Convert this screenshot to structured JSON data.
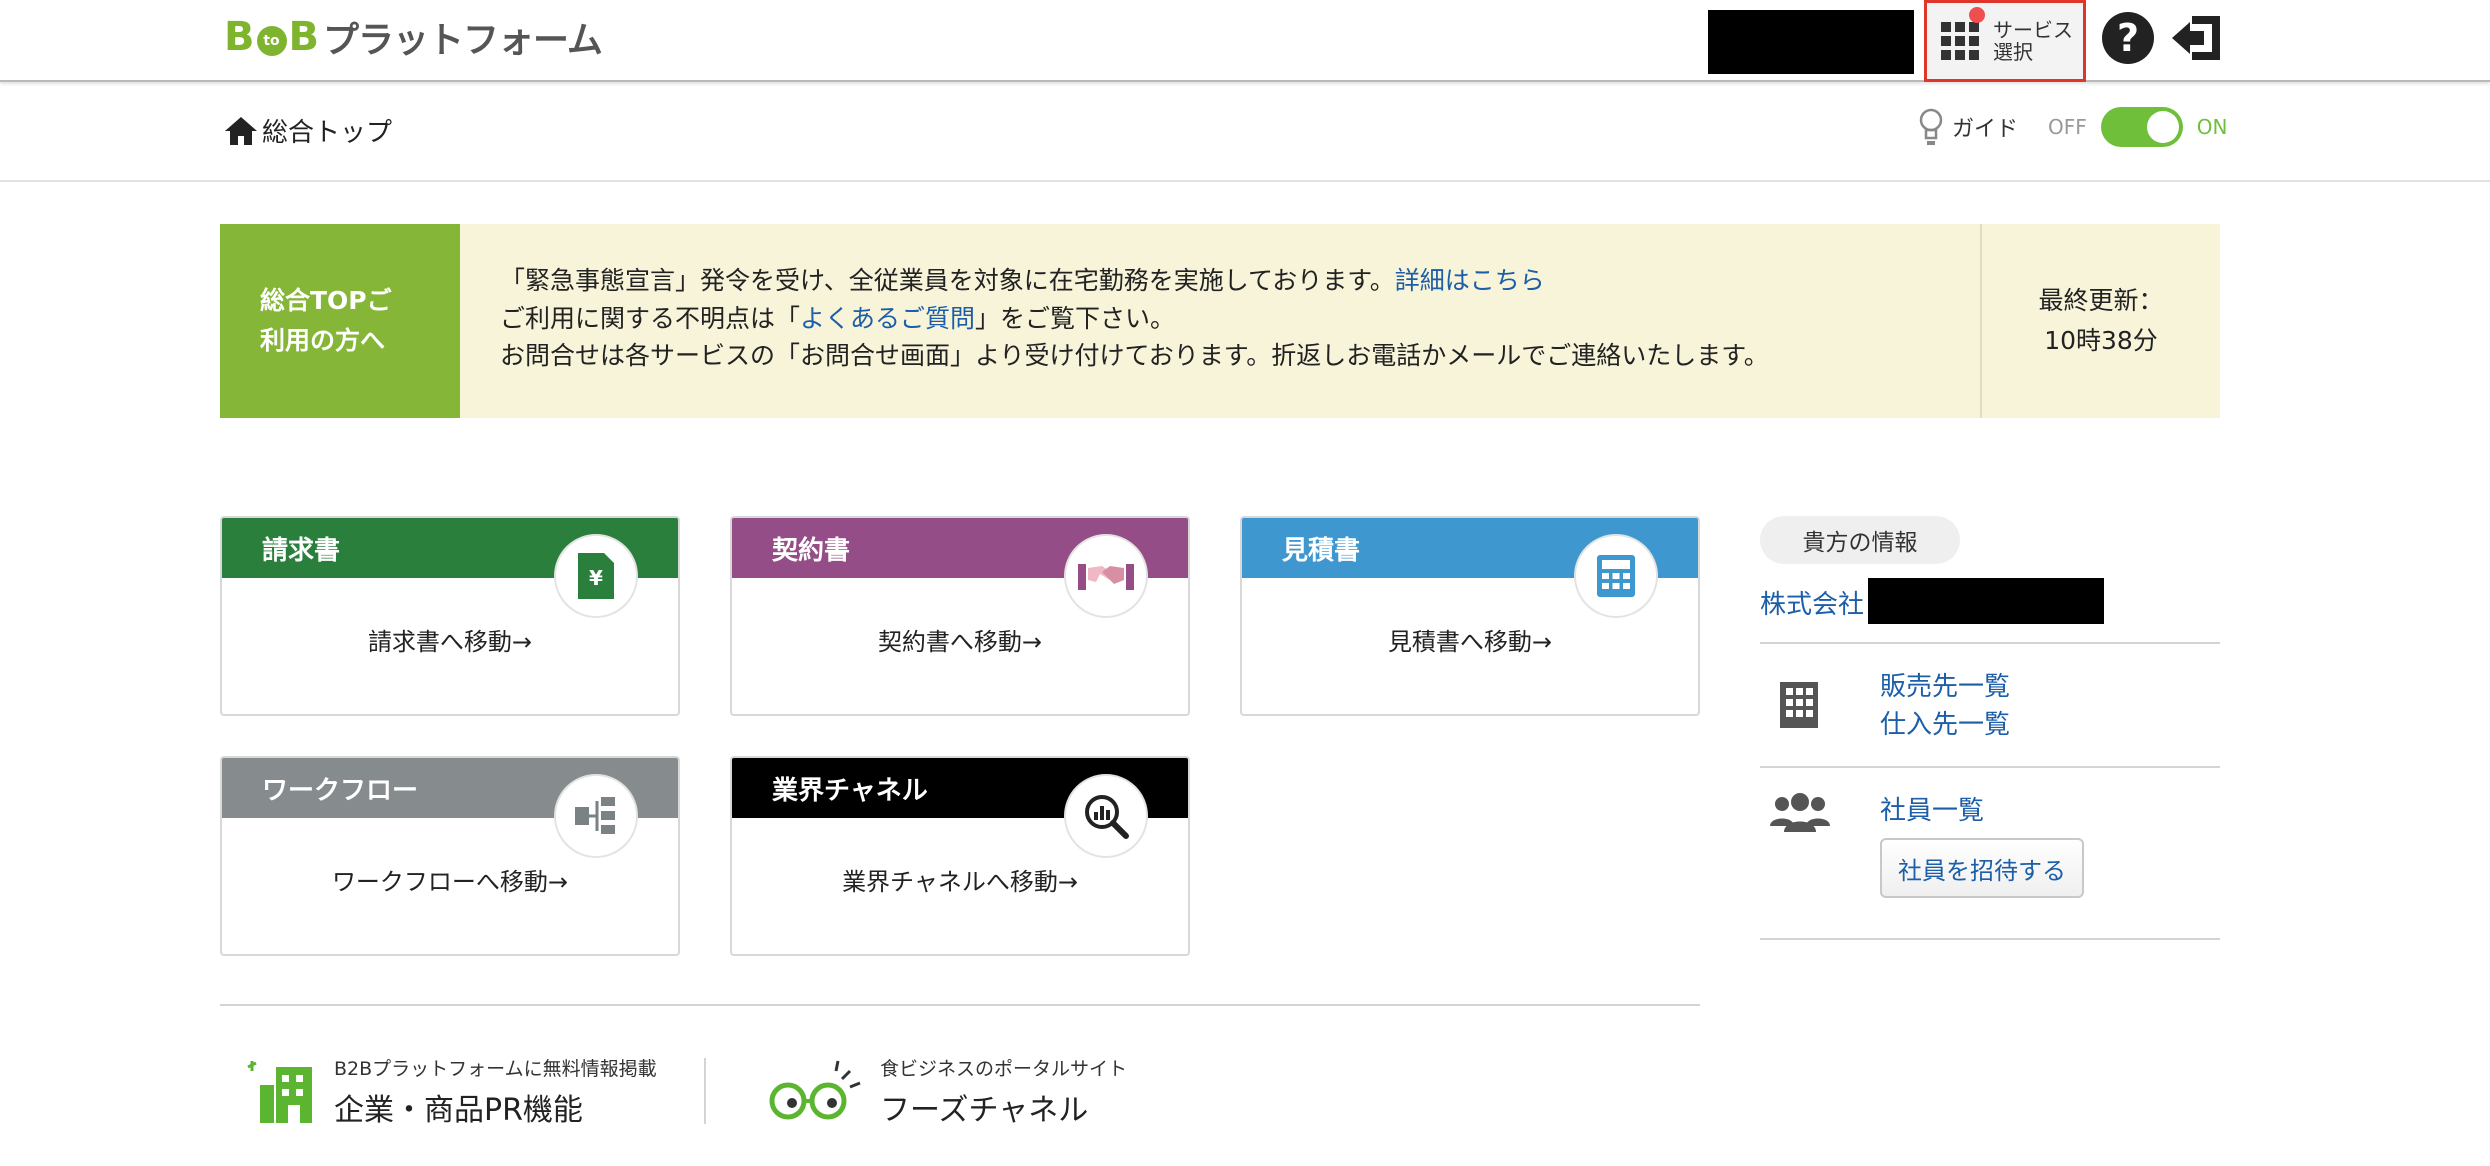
{
  "header": {
    "logo": {
      "b1": "B",
      "to": "to",
      "b2": "B",
      "text": "プラットフォーム"
    },
    "service_select_label": "サービス選択",
    "help_symbol": "?"
  },
  "subbar": {
    "home_label": "総合トップ",
    "guide_label": "ガイド",
    "toggle_off": "OFF",
    "toggle_on": "ON",
    "guide_enabled": true
  },
  "notice": {
    "tag_line1": "総合TOPご",
    "tag_line2": "利用の方へ",
    "line1_text": "「緊急事態宣言」発令を受け、全従業員を対象に在宅勤務を実施しております。",
    "line1_link": "詳細はこちら",
    "line2_pre": "ご利用に関する不明点は「",
    "line2_link": "よくあるご質問",
    "line2_post": "」をご覧下さい。",
    "line3_text": "お問合せは各サービスの「お問合せ画面」より受け付けております。折返しお電話かメールでご連絡いたします。",
    "update_label": "最終更新：",
    "update_time": "10時38分"
  },
  "cards": [
    {
      "title": "請求書",
      "link": "請求書へ移動→",
      "color": "#2a7f3c",
      "icon": "yen-document-icon"
    },
    {
      "title": "契約書",
      "link": "契約書へ移動→",
      "color": "#944d86",
      "icon": "handshake-icon"
    },
    {
      "title": "見積書",
      "link": "見積書へ移動→",
      "color": "#3f97cf",
      "icon": "calculator-icon"
    },
    {
      "title": "ワークフロー",
      "link": "ワークフローへ移動→",
      "color": "#868c8e",
      "icon": "workflow-icon"
    },
    {
      "title": "業界チャネル",
      "link": "業界チャネルへ移動→",
      "color": "#000000",
      "icon": "magnifier-chart-icon"
    }
  ],
  "side": {
    "info_label": "貴方の情報",
    "company_prefix": "株式会社",
    "customers_link": "販売先一覧",
    "suppliers_link": "仕入先一覧",
    "employees_link": "社員一覧",
    "invite_button": "社員を招待する"
  },
  "footer": {
    "pr_small": "B2Bプラットフォームに無料情報掲載",
    "pr_big": "企業・商品PR機能",
    "foods_small": "食ビジネスのポータルサイト",
    "foods_big": "フーズチャネル"
  },
  "colors": {
    "brand_green": "#85b637",
    "link_blue": "#1c5ea8",
    "highlight_red": "#e0352b"
  }
}
